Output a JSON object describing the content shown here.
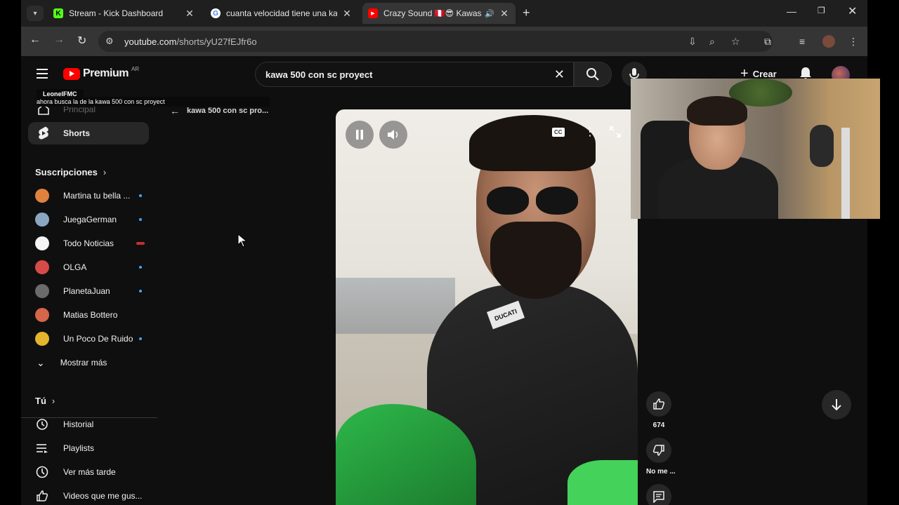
{
  "browser": {
    "tabs": [
      {
        "title": "Stream - Kick Dashboard",
        "favicon": "kick-icon",
        "color": "#53fc18",
        "active": false
      },
      {
        "title": "cuanta velocidad tiene una kaw",
        "favicon": "google-icon",
        "color": "#4285f4",
        "active": false
      },
      {
        "title": "Crazy Sound 🇵🇪😎 Kawasa",
        "favicon": "youtube-icon",
        "color": "#ff0000",
        "active": true
      }
    ],
    "url_main": "youtube.com",
    "url_path": "/shorts/yU27fEJfr6o"
  },
  "youtube": {
    "logo_word": "Premium",
    "country": "AR",
    "search_query": "kawa 500 con sc proyect",
    "create_label": "Crear",
    "accent": "#ff0000"
  },
  "sidebar": {
    "home_label": "Principal",
    "shorts_label": "Shorts",
    "subs_heading": "Suscripciones",
    "subscriptions": [
      {
        "name": "Martina tu bella ...",
        "indicator": "dot",
        "color": "#e0823e"
      },
      {
        "name": "JuegaGerman",
        "indicator": "dot",
        "color": "#8aa6c1"
      },
      {
        "name": "Todo Noticias",
        "indicator": "live",
        "color": "#f4f4f4"
      },
      {
        "name": "OLGA",
        "indicator": "dot",
        "color": "#d64a4a"
      },
      {
        "name": "PlanetaJuan",
        "indicator": "dot",
        "color": "#6b6b6b"
      },
      {
        "name": "Matias Bottero",
        "indicator": "none",
        "color": "#d5654b"
      },
      {
        "name": "Un Poco De Ruido",
        "indicator": "dot",
        "color": "#e3b42c"
      }
    ],
    "show_more": "Mostrar más",
    "you_heading": "Tú",
    "you_items": [
      {
        "label": "Historial",
        "icon": "history-icon"
      },
      {
        "label": "Playlists",
        "icon": "playlists-icon"
      },
      {
        "label": "Ver más tarde",
        "icon": "watch-later-icon"
      },
      {
        "label": "Videos que me gus...",
        "icon": "liked-videos-icon"
      }
    ]
  },
  "chat_overlay": {
    "username": "LeonelFMC",
    "message": "ahora busca la de la kawa 500 con sc proyect"
  },
  "back_query": "kawa 500 con sc pro...",
  "short": {
    "jacket_patch": "DUCATI",
    "like_count": "674",
    "dislike_label": "No me ...",
    "cc_label": "CC"
  }
}
